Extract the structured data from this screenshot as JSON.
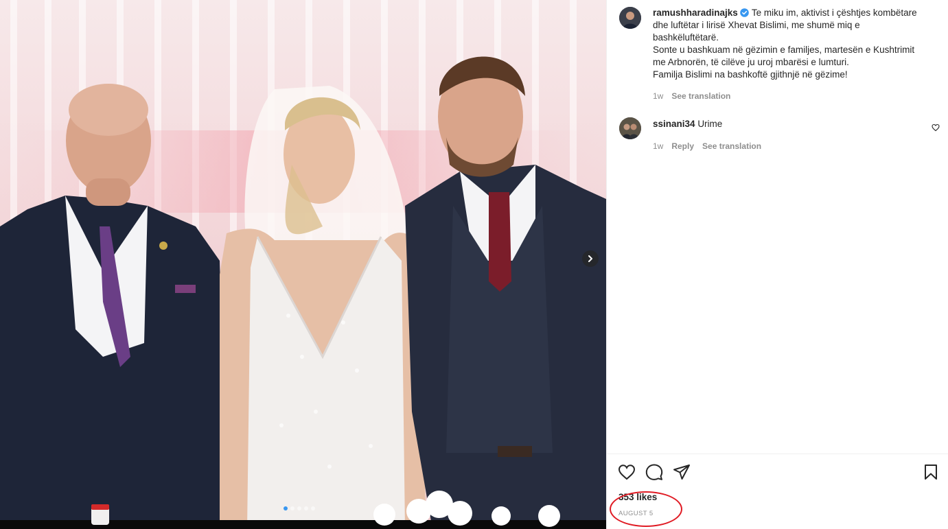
{
  "media": {
    "carousel_dots": 5,
    "active_dot": 0,
    "next_icon": "chevron-right-icon"
  },
  "post": {
    "username": "ramushharadinajks",
    "verified": true,
    "caption_lines": [
      "Te miku im, aktivist i çështjes kombëtare",
      "dhe luftëtar i lirisë Xhevat Bislimi, me shumë miq e",
      "bashkëluftëtarë.",
      "Sonte u bashkuam në gëzimin e familjes, martesën e Kushtrimit",
      "me Arbnorën, të cilëve ju uroj mbarësi e lumturi.",
      "Familja Bislimi na bashkoftë gjithnjë në gëzime!"
    ],
    "age": "1w",
    "see_translation": "See translation"
  },
  "comments": [
    {
      "username": "ssinani34",
      "text": "Urime",
      "age": "1w",
      "reply": "Reply",
      "see_translation": "See translation"
    }
  ],
  "actions": {
    "like_icon": "heart-icon",
    "comment_icon": "comment-icon",
    "share_icon": "share-icon",
    "save_icon": "bookmark-icon"
  },
  "likes": "353 likes",
  "date": "AUGUST 5",
  "colors": {
    "verified": "#3897f0",
    "annotation": "#e01b24",
    "muted_text": "#8e8e8e"
  }
}
